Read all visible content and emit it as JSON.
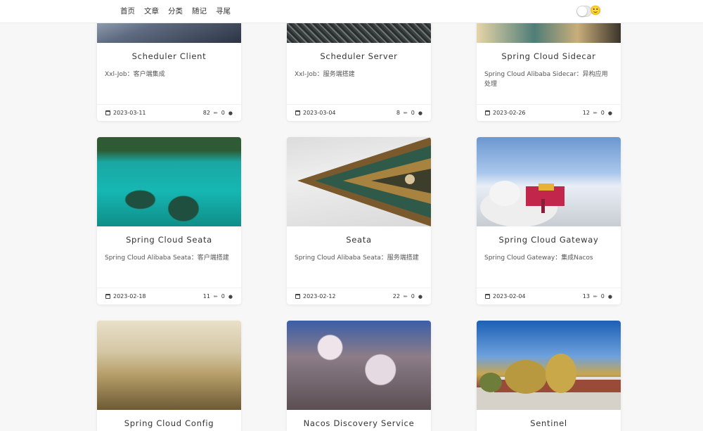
{
  "nav": [
    "首页",
    "文章",
    "分类",
    "随记",
    "寻尾"
  ],
  "theme_toggle": {
    "emoji": "🙂"
  },
  "cards": [
    {
      "title": "Scheduler Client",
      "desc": "Xxl-Job：客户端集成",
      "date": "2023-03-11",
      "views": "82",
      "comments": "0",
      "thumb": "t-scheduler-client"
    },
    {
      "title": "Scheduler Server",
      "desc": "Xxl-Job：服务端搭建",
      "date": "2023-03-04",
      "views": "8",
      "comments": "0",
      "thumb": "t-scheduler-server"
    },
    {
      "title": "Spring Cloud Sidecar",
      "desc": "Spring Cloud Alibaba Sidecar：异构应用处理",
      "date": "2023-02-26",
      "views": "12",
      "comments": "0",
      "thumb": "t-sidecar"
    },
    {
      "title": "Spring Cloud Seata",
      "desc": "Spring Cloud Alibaba Seata：客户端搭建",
      "date": "2023-02-18",
      "views": "11",
      "comments": "0",
      "thumb": "t-seata-client"
    },
    {
      "title": "Seata",
      "desc": "Spring Cloud Alibaba Seata：服务端搭建",
      "date": "2023-02-12",
      "views": "22",
      "comments": "0",
      "thumb": "t-seata-server"
    },
    {
      "title": "Spring Cloud Gateway",
      "desc": "Spring Cloud Gateway：集成Nacos",
      "date": "2023-02-04",
      "views": "13",
      "comments": "0",
      "thumb": "t-gateway"
    },
    {
      "title": "Spring Cloud Config",
      "desc": "",
      "date": "",
      "views": "",
      "comments": "",
      "thumb": "t-config"
    },
    {
      "title": "Nacos Discovery Service",
      "desc": "",
      "date": "",
      "views": "",
      "comments": "",
      "thumb": "t-nacos"
    },
    {
      "title": "Sentinel",
      "desc": "",
      "date": "",
      "views": "",
      "comments": "",
      "thumb": "t-sentinel"
    }
  ]
}
